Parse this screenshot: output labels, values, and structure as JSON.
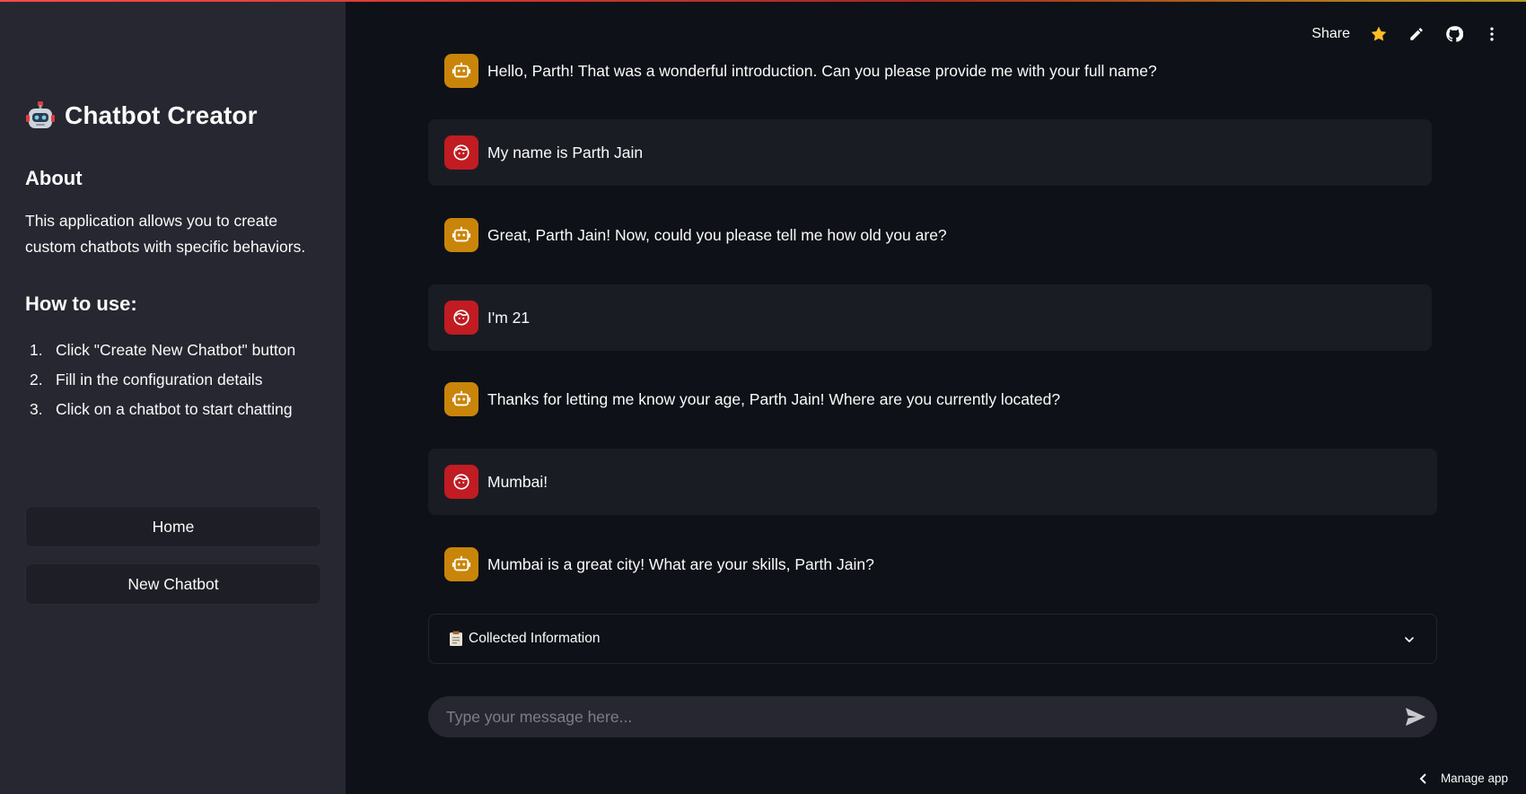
{
  "app": {
    "title": "Chatbot Creator"
  },
  "sidebar": {
    "about_heading": "About",
    "about_text": "This application allows you to create custom chatbots with specific behaviors.",
    "howto_heading": "How to use:",
    "steps": [
      {
        "num": "1.",
        "text": "Click \"Create New Chatbot\" button"
      },
      {
        "num": "2.",
        "text": "Fill in the configuration details"
      },
      {
        "num": "3.",
        "text": "Click on a chatbot to start chatting"
      }
    ],
    "home_button": "Home",
    "new_chatbot_button": "New Chatbot"
  },
  "toolbar": {
    "share": "Share",
    "icons": [
      "star-icon",
      "edit-icon",
      "github-icon",
      "more-vert-icon"
    ]
  },
  "messages": [
    {
      "role": "assistant",
      "text": "Hello, Parth! That was a wonderful introduction. Can you please provide me with your full name?"
    },
    {
      "role": "user",
      "text": "My name is Parth Jain"
    },
    {
      "role": "assistant",
      "text": "Great, Parth Jain! Now, could you please tell me how old you are?"
    },
    {
      "role": "user",
      "text": "I'm 21"
    },
    {
      "role": "assistant",
      "text": "Thanks for letting me know your age, Parth Jain! Where are you currently located?"
    },
    {
      "role": "user",
      "text": "Mumbai!"
    },
    {
      "role": "assistant",
      "text": "Mumbai is a great city! What are your skills, Parth Jain?"
    }
  ],
  "expander": {
    "label": "Collected Information"
  },
  "chat_input": {
    "placeholder": "Type your message here..."
  },
  "footer": {
    "manage_app": "Manage app"
  },
  "colors": {
    "background": "#0e1117",
    "sidebar": "#262730",
    "bot_avatar": "#c9850a",
    "user_avatar": "#c01c22",
    "star": "#fbbf24"
  }
}
